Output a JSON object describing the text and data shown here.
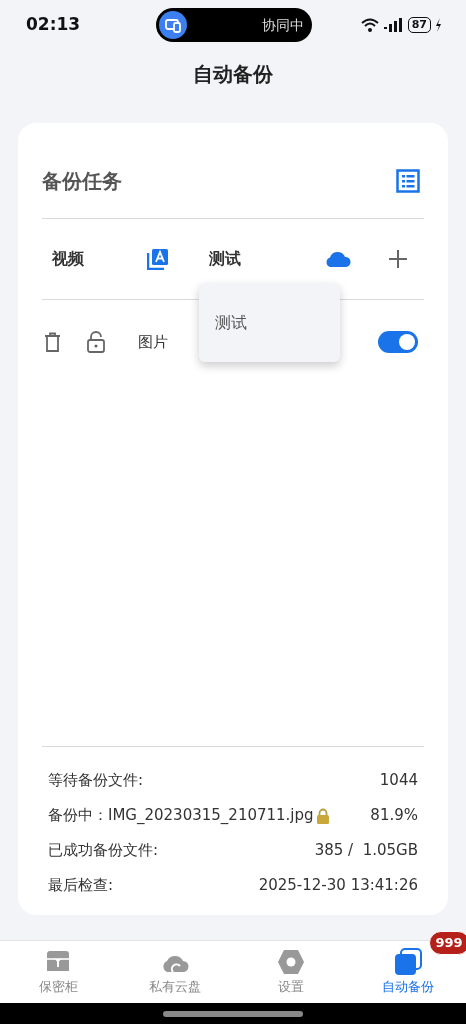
{
  "status_bar": {
    "time": "02:13",
    "activity_label": "协同中",
    "battery": "87"
  },
  "title": "自动备份",
  "card": {
    "title": "备份任务",
    "route": {
      "source": "视频",
      "target": "测试"
    },
    "menu": {
      "items": [
        {
          "label": "测试"
        }
      ]
    },
    "tasks": [
      {
        "name": "图片",
        "enabled": true
      }
    ],
    "stats": [
      {
        "label": "等待备份文件:",
        "value": "1044"
      },
      {
        "label": "备份中：",
        "file": "IMG_20230315_210711.jpg",
        "locked": true,
        "value": "81.9%"
      },
      {
        "label": "已成功备份文件:",
        "value": "385 /  1.05GB"
      },
      {
        "label": "最后检查:",
        "value": "2025-12-30 13:41:26"
      }
    ]
  },
  "nav": [
    {
      "label": "保密柜",
      "kind": "safe",
      "selected": false
    },
    {
      "label": "私有云盘",
      "kind": "cloud",
      "selected": false
    },
    {
      "label": "设置",
      "kind": "settings",
      "selected": false
    },
    {
      "label": "自动备份",
      "kind": "backup",
      "selected": true,
      "badge": "999"
    }
  ]
}
